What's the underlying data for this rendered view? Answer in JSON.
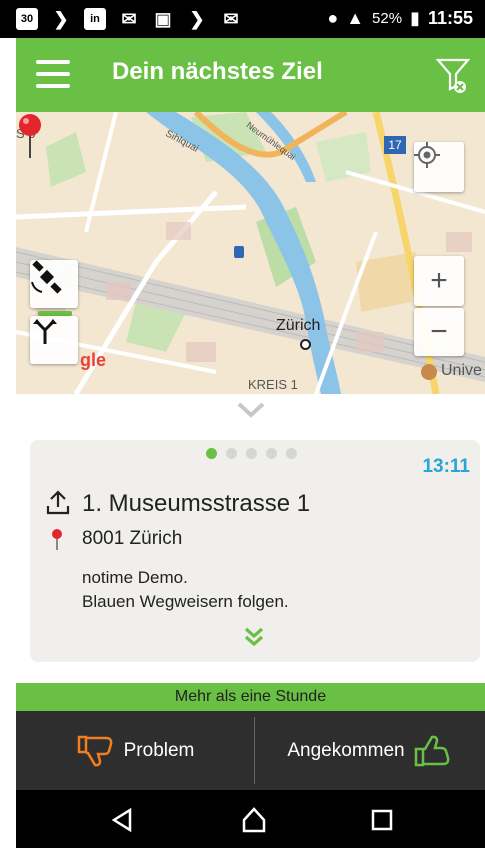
{
  "status_bar": {
    "notif_30": "30",
    "notif_linkedin": "in",
    "battery": "52%",
    "time": "11:55"
  },
  "header": {
    "title": "Dein nächstes Ziel"
  },
  "map": {
    "labels": {
      "city": "Zürich",
      "district": "KREIS 1",
      "uni": "Unive",
      "s5": "S 5",
      "line17": "17",
      "google": "gle",
      "street1": "Sihlquai",
      "street2": "Neumühlequai"
    }
  },
  "card": {
    "time": "13:11",
    "pager_total": 5,
    "pager_active": 1,
    "address_line": "1. Museumsstrasse 1",
    "city_line": "8001 Zürich",
    "note_line1": "notime Demo.",
    "note_line2": "Blauen Wegweisern folgen."
  },
  "eta_bar": {
    "label": "Mehr als eine Stunde"
  },
  "actions": {
    "problem_label": "Problem",
    "arrived_label": "Angekommen"
  },
  "colors": {
    "brand_green": "#6abf45",
    "time_blue": "#27a5d8",
    "pin_red": "#e3262d",
    "problem_orange": "#f07f1f"
  }
}
